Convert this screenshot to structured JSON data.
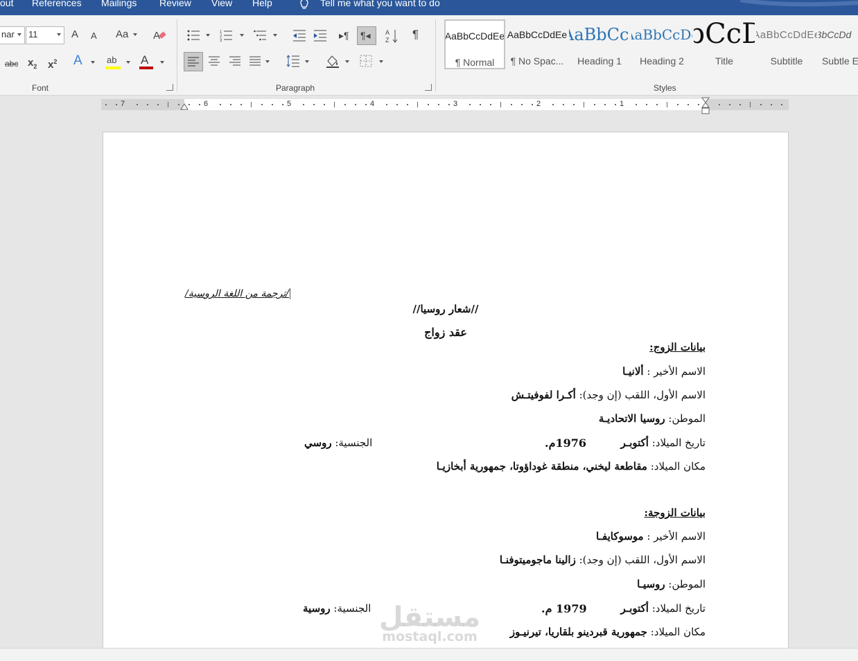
{
  "menu": {
    "items": [
      "out",
      "References",
      "Mailings",
      "Review",
      "View",
      "Help"
    ],
    "tell_me": "Tell me what you want to do"
  },
  "font": {
    "name_value": "nar",
    "size_value": "11",
    "group_label": "Font",
    "grow_icon": "A",
    "shrink_icon": "A",
    "case_icon": "Aa",
    "strike_icon": "abc",
    "subscript_icon": "x",
    "superscript_icon": "x",
    "effects_icon": "A",
    "highlight_icon": "ab",
    "color_icon": "A",
    "highlight_color": "#ffff00",
    "font_color": "#c00000"
  },
  "paragraph": {
    "group_label": "Paragraph",
    "pilcrow": "¶"
  },
  "styles": {
    "group_label": "Styles",
    "items": [
      {
        "preview": "AaBbCcDdEe",
        "name": "¶ Normal"
      },
      {
        "preview": "AaBbCcDdEe",
        "name": "¶ No Spac..."
      },
      {
        "preview": "AaBbCcDdEe",
        "name": "Heading 1"
      },
      {
        "preview": "AaBbCcDdEe",
        "name": "Heading 2"
      },
      {
        "preview": "AaBbCcDdEe",
        "name": "Title"
      },
      {
        "preview": "AaBbCcDdEe",
        "name": "Subtitle"
      },
      {
        "preview": "AaBbCcDd",
        "name": "Subtle Emphasis"
      }
    ]
  },
  "ruler": {
    "numbers": [
      "7",
      "6",
      "5",
      "4",
      "3",
      "2",
      "1"
    ]
  },
  "document": {
    "translation_note": "/ترجمة من اللغة الروسية/",
    "emblem": "//شعار روسيا//",
    "title": "عقد زواج",
    "husband": {
      "heading": "بيانات الزوج:",
      "last_name_label": "الاسم الأخير : ",
      "last_name": "ألانيـا",
      "first_name_label": "الاسم الأول، اللقب (إن وجد): ",
      "first_name": "أكـرا لفوفيتـش",
      "homeland_label": "الموطن: ",
      "homeland": "روسيا الاتحاديـة",
      "birth_date_label": "تاريخ الميلاد: ",
      "birth_month": "أكتوبـر",
      "birth_year": "1976م.",
      "nationality_label": "الجنسية: ",
      "nationality": "روسي",
      "birth_place_label": "مكان الميلاد: ",
      "birth_place": "مقاطعة ليخني، منطقة غوداؤوتا، جمهورية أبخازيـا"
    },
    "wife": {
      "heading": "بيانات الزوجة:",
      "last_name_label": "الاسم الأخير : ",
      "last_name": "موسوكايفـا",
      "first_name_label": "الاسم الأول، اللقب (إن وجد): ",
      "first_name": "زالينا ماجوميتوفنـا",
      "homeland_label": "الموطن: ",
      "homeland": "روسيـا",
      "birth_date_label": "تاريخ الميلاد: ",
      "birth_month": "أكتوبـر",
      "birth_year": "1979 م.",
      "nationality_label": "الجنسية: ",
      "nationality": "روسية",
      "birth_place_label": "مكان الميلاد: ",
      "birth_place": "جمهورية قبردينو بلقاريا، تيرنيـوز"
    }
  },
  "watermark": {
    "arabic": "مستقل",
    "latin": "mostaql.com"
  }
}
